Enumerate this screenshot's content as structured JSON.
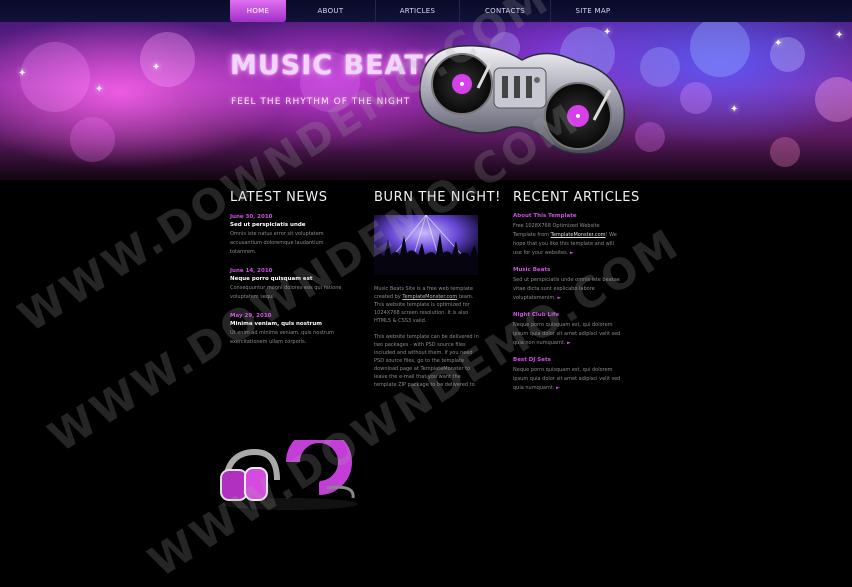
{
  "nav": [
    "HOME",
    "ABOUT",
    "ARTICLES",
    "CONTACTS",
    "SITE MAP"
  ],
  "header": {
    "title": "MUSIC BEATS",
    "subtitle": "FEEL THE RHYTHM OF THE NIGHT"
  },
  "latest_news": {
    "title": "LATEST NEWS",
    "items": [
      {
        "date": "June 30, 2010",
        "headline": "Sed ut perspiciatis unde",
        "body": "Omnis iste natus error sit voluptatem accusantium doloremque laudantium totamrem."
      },
      {
        "date": "June 14, 2010",
        "headline": "Neque porro quisquam est",
        "body": "Consequuntur magni dolores eos qui ratione voluptatem sequi."
      },
      {
        "date": "May 29, 2010",
        "headline": "Minima veniam, quis nostrum",
        "body": "Ut enim ad minima veniam, quis nostrum exercitationem ullam corporis."
      }
    ]
  },
  "burn": {
    "title": "BURN THE NIGHT!",
    "p1_a": "Music Beats Site is a free web template created by ",
    "p1_link": "TemplateMonster.com",
    "p1_b": " team. This website template is optimized for 1024X768 screen resolution. It is also HTML5 & CSS3 valid.",
    "p2": "This website template can be delivered in two packages - with PSD source files included and without them. If you need PSD source files, go to the template download page at TemplateMonster to leave the e-mail that you want the template ZIP package to be delivered to."
  },
  "recent_articles": {
    "title": "RECENT ARTICLES",
    "items": [
      {
        "title": "About This Template",
        "body_a": "Free 1028X768 Optimized Website Template from ",
        "link": "TemplateMonster.com",
        "body_b": "! We hope that you like this template and will use for your websites."
      },
      {
        "title": "Music Beats",
        "body_a": "Sed ut perspiciatis unde omnis iste beatae vitae dicta sunt explicabo labore voluptatemenim.",
        "link": "",
        "body_b": ""
      },
      {
        "title": "Night Club Life",
        "body_a": "Neque porro quisquam est, qui dolorem ipsum quia dolor sit amet adipisci velit sed quia non numquamt.",
        "link": "",
        "body_b": ""
      },
      {
        "title": "Best DJ Sets",
        "body_a": "Neque porro quisquam est, qui dolorem ipsum quia dolor sit amet adipisci velit sed quia numquamt.",
        "link": "",
        "body_b": ""
      }
    ]
  },
  "watermark": "WWW.DOWNDEMO.COM",
  "colors": {
    "accent": "#d24ee6",
    "nav_active": "#c050e0",
    "background": "#000000"
  },
  "icons": [
    "dj-turntable-icon",
    "headphones-icon",
    "arrow-icon"
  ]
}
